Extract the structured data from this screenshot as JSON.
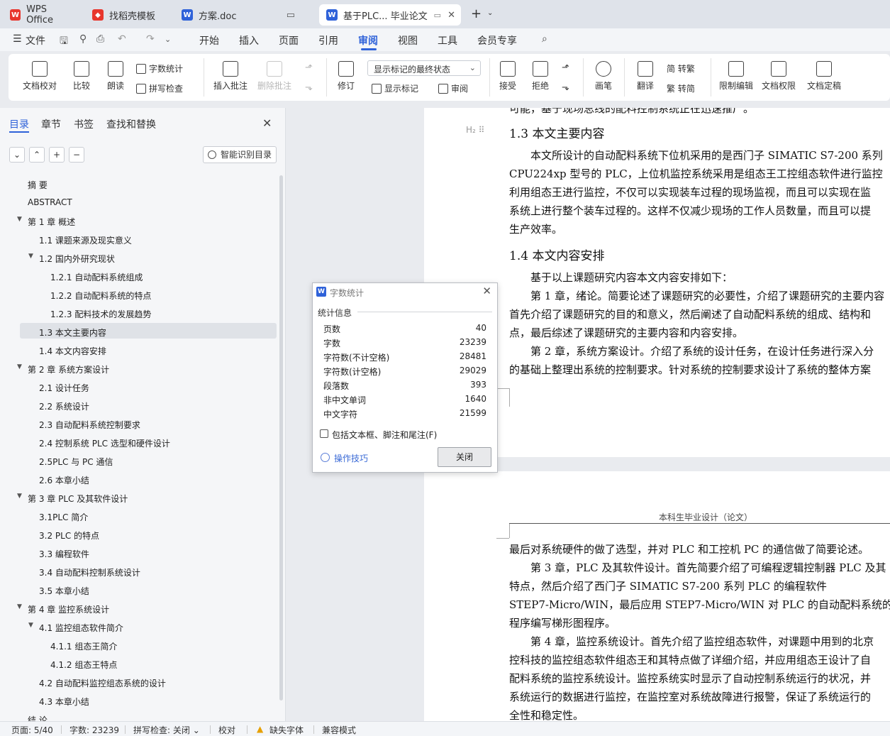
{
  "tabs": [
    {
      "label": "WPS Office",
      "icon": "wps-logo-icon",
      "color": "#e8362d"
    },
    {
      "label": "找稻壳模板",
      "icon": "docer-logo-icon",
      "color": "#e8362d"
    },
    {
      "label": "方案.doc",
      "icon": "writer-doc-icon",
      "color": "#2f62d9"
    },
    {
      "label": "基于PLC... 毕业论文",
      "icon": "writer-doc-icon",
      "color": "#2f62d9"
    }
  ],
  "menu": {
    "file": "文件",
    "items": [
      "开始",
      "插入",
      "页面",
      "引用",
      "审阅",
      "视图",
      "工具",
      "会员专享"
    ],
    "active": "审阅"
  },
  "ribbon": {
    "doc_check": "文档校对",
    "compare": "比较",
    "read_aloud": "朗读",
    "word_count": "字数统计",
    "spell_check": "拼写检查",
    "insert_comment": "插入批注",
    "delete_comment": "删除批注",
    "revise": "修订",
    "display_select": "显示标记的最终状态",
    "show_markup": "显示标记",
    "review": "审阅",
    "accept": "接受",
    "reject": "拒绝",
    "pen": "画笔",
    "translate": "翻译",
    "to_traditional": "简 转繁",
    "to_simplified": "繁 转简",
    "restrict_edit": "限制编辑",
    "doc_permission": "文档权限",
    "doc_finalize": "文档定稿"
  },
  "nav": {
    "tabs": [
      "目录",
      "章节",
      "书签",
      "查找和替换"
    ],
    "smart_toc": "智能识别目录",
    "toc": [
      {
        "text": "摘 要",
        "level": 1
      },
      {
        "text": "ABSTRACT",
        "level": 1
      },
      {
        "text": "第 1 章 概述",
        "level": 1,
        "expanded": true
      },
      {
        "text": "1.1 课题来源及现实意义",
        "level": 2
      },
      {
        "text": "1.2 国内外研究现状",
        "level": 2,
        "expanded": true
      },
      {
        "text": "1.2.1 自动配料系统组成",
        "level": 3
      },
      {
        "text": "1.2.2 自动配料系统的特点",
        "level": 3
      },
      {
        "text": "1.2.3 配料技术的发展趋势",
        "level": 3
      },
      {
        "text": "1.3 本文主要内容",
        "level": 2,
        "selected": true
      },
      {
        "text": "1.4 本文内容安排",
        "level": 2
      },
      {
        "text": "第 2 章 系统方案设计",
        "level": 1,
        "expanded": true
      },
      {
        "text": "2.1 设计任务",
        "level": 2
      },
      {
        "text": "2.2 系统设计",
        "level": 2
      },
      {
        "text": "2.3 自动配料系统控制要求",
        "level": 2
      },
      {
        "text": "2.4 控制系统 PLC 选型和硬件设计",
        "level": 2
      },
      {
        "text": "2.5PLC 与 PC 通信",
        "level": 2
      },
      {
        "text": "2.6 本章小结",
        "level": 2
      },
      {
        "text": "第 3 章 PLC 及其软件设计",
        "level": 1,
        "expanded": true
      },
      {
        "text": "3.1PLC 简介",
        "level": 2
      },
      {
        "text": "3.2 PLC 的特点",
        "level": 2
      },
      {
        "text": "3.3 编程软件",
        "level": 2
      },
      {
        "text": "3.4 自动配料控制系统设计",
        "level": 2
      },
      {
        "text": "3.5 本章小结",
        "level": 2
      },
      {
        "text": "第 4 章 监控系统设计",
        "level": 1,
        "expanded": true
      },
      {
        "text": "4.1 监控组态软件简介",
        "level": 2,
        "expanded": true
      },
      {
        "text": "4.1.1 组态王简介",
        "level": 3
      },
      {
        "text": "4.1.2 组态王特点",
        "level": 3
      },
      {
        "text": "4.2 自动配料监控组态系统的设计",
        "level": 2
      },
      {
        "text": "4.3 本章小结",
        "level": 2
      },
      {
        "text": "结 论",
        "level": 1
      }
    ]
  },
  "document": {
    "top_cut": "可能，基于现场总线的配料控制系统正在迅速推广。",
    "h2_marker": "H₂",
    "heading_1_3": "1.3 本文主要内容",
    "p1": [
      "本文所设计的自动配料系统下位机采用的是西门子 SIMATIC S7-200 系列",
      "CPU224xp 型号的 PLC，上位机监控系统采用是组态王工控组态软件进行监控",
      "利用组态王进行监控，不仅可以实现装车过程的现场监视，而且可以实现在监",
      "系统上进行整个装车过程的。这样不仅减少现场的工作人员数量，而且可以提",
      "生产效率。"
    ],
    "heading_1_4": "1.4 本文内容安排",
    "p2": [
      "基于以上课题研究内容本文内容安排如下：",
      "第 1 章，绪论。简要论述了课题研究的必要性，介绍了课题研究的主要内容",
      "首先介绍了课题研究的目的和意义，然后阐述了自动配料系统的组成、结构和",
      "点，最后综述了课题研究的主要内容和内容安排。",
      "第 2 章，系统方案设计。介绍了系统的设计任务，在设计任务进行深入分",
      "的基础上整理出系统的控制要求。针对系统的控制要求设计了系统的整体方案"
    ],
    "page_header": "本科生毕业设计（论文）",
    "p3": [
      "最后对系统硬件的做了选型，并对 PLC 和工控机 PC 的通信做了简要论述。",
      "第 3 章，PLC 及其软件设计。首先简要介绍了可编程逻辑控制器 PLC 及其",
      "特点，然后介绍了西门子 SIMATIC S7-200 系列 PLC 的编程软件",
      "STEP7-Micro/WIN，最后应用 STEP7-Micro/WIN 对 PLC 的自动配料系统的控",
      "程序编写梯形图程序。",
      "第 4 章，监控系统设计。首先介绍了监控组态软件，对课题中用到的北京",
      "控科技的监控组态软件组态王和其特点做了详细介绍，并应用组态王设计了自",
      "配料系统的监控系统设计。监控系统实时显示了自动控制系统运行的状况，并",
      "系统运行的数据进行监控，在监控室对系统故障进行报警，保证了系统运行的",
      "全性和稳定性。"
    ]
  },
  "dialog": {
    "title": "字数统计",
    "section": "统计信息",
    "stats": [
      {
        "label": "页数",
        "value": "40"
      },
      {
        "label": "字数",
        "value": "23239"
      },
      {
        "label": "字符数(不计空格)",
        "value": "28481"
      },
      {
        "label": "字符数(计空格)",
        "value": "29029"
      },
      {
        "label": "段落数",
        "value": "393"
      },
      {
        "label": "非中文单词",
        "value": "1640"
      },
      {
        "label": "中文字符",
        "value": "21599"
      }
    ],
    "checkbox_label": "包括文本框、脚注和尾注(F)",
    "checkbox_checked": false,
    "tips": "操作技巧",
    "close_button": "关闭"
  },
  "status": {
    "page": "页面: 5/40",
    "word_count": "字数: 23239",
    "spell_check": "拼写检查: 关闭",
    "proofread": "校对",
    "missing_font": "缺失字体",
    "compat_mode": "兼容模式"
  }
}
